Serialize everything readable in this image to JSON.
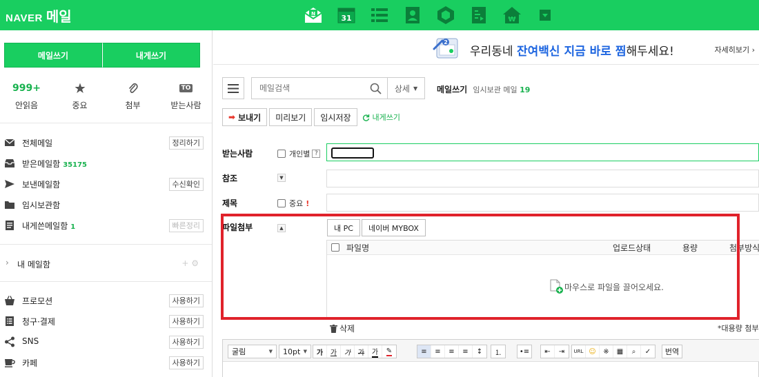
{
  "header": {
    "brand": "NAVER",
    "service": "메일",
    "apps": [
      "mail-icon",
      "calendar-icon",
      "contacts-list-icon",
      "address-book-icon",
      "cube-icon",
      "memo-icon",
      "household-ledger-icon",
      "more-dropdown-icon"
    ],
    "calendar_day": "31"
  },
  "sidebar": {
    "write_mail": "메일쓰기",
    "write_self": "내게쓰기",
    "quick": [
      {
        "label": "안읽음",
        "value": "999+"
      },
      {
        "label": "중요",
        "icon": "star-icon"
      },
      {
        "label": "첨부",
        "icon": "paperclip-icon"
      },
      {
        "label": "받는사람",
        "badge": "TO"
      }
    ],
    "folders": [
      {
        "name": "전체메일",
        "action": "정리하기",
        "icon": "envelope-icon"
      },
      {
        "name": "받은메일함",
        "count": "35175",
        "icon": "inbox-icon"
      },
      {
        "name": "보낸메일함",
        "action": "수신확인",
        "icon": "send-icon"
      },
      {
        "name": "임시보관함",
        "icon": "folder-icon"
      },
      {
        "name": "내게쓴메일함",
        "count": "1",
        "action": "빠른정리",
        "icon": "note-icon"
      }
    ],
    "my_mailbox": "내 메일함",
    "my_mailbox_actions": "+ ⚙",
    "extras": [
      {
        "name": "프로모션",
        "action": "사용하기",
        "icon": "shopping-bag-icon"
      },
      {
        "name": "청구·결제",
        "action": "사용하기",
        "icon": "bill-icon"
      },
      {
        "name": "SNS",
        "action": "사용하기",
        "icon": "share-icon"
      },
      {
        "name": "카페",
        "action": "사용하기",
        "icon": "coffee-cup-icon"
      }
    ]
  },
  "banner": {
    "pre": "우리동네 ",
    "highlight": "잔여백신 지금 바로 찜",
    "post": "해두세요!",
    "more": "자세히보기 ›",
    "badge": "2"
  },
  "toolbar": {
    "search_placeholder": "메일검색",
    "detail": "상세",
    "compose_title": "메일쓰기",
    "drafts_label": "임시보관 메일",
    "drafts_count": "19",
    "send": "보내기",
    "preview": "미리보기",
    "save_draft": "임시저장",
    "self_write": "내게쓰기"
  },
  "form": {
    "to_label": "받는사람",
    "individual": "개인별",
    "help": "?",
    "cc_label": "참조",
    "subject_label": "제목",
    "important": "중요",
    "important_mark": "!",
    "attach_label": "파일첨부"
  },
  "attachments": {
    "my_pc": "내 PC",
    "mybox": "네이버 MYBOX",
    "col_filename": "파일명",
    "col_status": "업로드상태",
    "col_size": "용량",
    "col_method": "첨부방식",
    "drop_hint": "마우스로 파일을 끌어오세요.",
    "delete": "삭제",
    "bulk_note": "*대용량 첨부"
  },
  "editor": {
    "font": "굴림",
    "size": "10pt",
    "translate": "번역",
    "url": "URL"
  },
  "colors": {
    "naver_green": "#19ce60",
    "count_green": "#19b24f",
    "highlight_red": "#e0222b",
    "banner_blue": "#1d65e0"
  }
}
